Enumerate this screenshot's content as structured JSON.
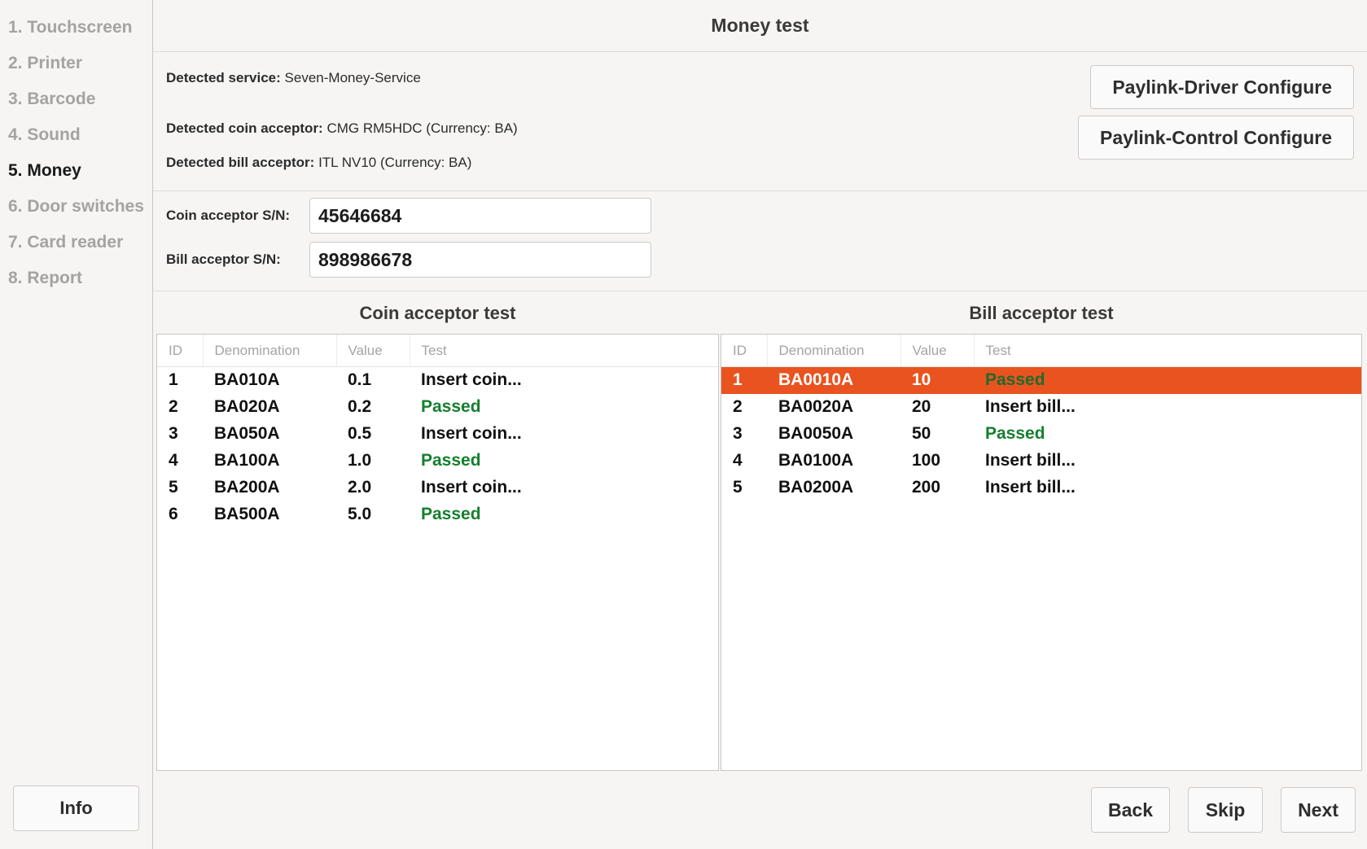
{
  "sidebar": {
    "items": [
      {
        "label": "1. Touchscreen",
        "active": false
      },
      {
        "label": "2. Printer",
        "active": false
      },
      {
        "label": "3. Barcode",
        "active": false
      },
      {
        "label": "4. Sound",
        "active": false
      },
      {
        "label": "5. Money",
        "active": true
      },
      {
        "label": "6. Door switches",
        "active": false
      },
      {
        "label": "7. Card reader",
        "active": false
      },
      {
        "label": "8. Report",
        "active": false
      }
    ],
    "info_label": "Info"
  },
  "header": {
    "title": "Money test"
  },
  "detected": {
    "service_label": "Detected service:",
    "service_value": "Seven-Money-Service",
    "coin_label": "Detected coin acceptor:",
    "coin_value": "CMG RM5HDC (Currency: BA)",
    "bill_label": "Detected bill acceptor:",
    "bill_value": "ITL NV10 (Currency: BA)"
  },
  "configure_buttons": {
    "driver": "Paylink-Driver Configure",
    "control": "Paylink-Control Configure"
  },
  "serial_numbers": {
    "coin_label": "Coin acceptor S/N:",
    "coin_value": "45646684",
    "coin_placeholder": "",
    "bill_label": "Bill acceptor S/N:",
    "bill_value": "898986678",
    "bill_placeholder": ""
  },
  "coin_table": {
    "caption": "Coin acceptor test",
    "columns": [
      "ID",
      "Denomination",
      "Value",
      "Test"
    ],
    "rows": [
      {
        "id": "1",
        "denomination": "BA010A",
        "value": "0.1",
        "test": "Insert coin...",
        "passed": false,
        "selected": false
      },
      {
        "id": "2",
        "denomination": "BA020A",
        "value": "0.2",
        "test": "Passed",
        "passed": true,
        "selected": false
      },
      {
        "id": "3",
        "denomination": "BA050A",
        "value": "0.5",
        "test": "Insert coin...",
        "passed": false,
        "selected": false
      },
      {
        "id": "4",
        "denomination": "BA100A",
        "value": "1.0",
        "test": "Passed",
        "passed": true,
        "selected": false
      },
      {
        "id": "5",
        "denomination": "BA200A",
        "value": "2.0",
        "test": "Insert coin...",
        "passed": false,
        "selected": false
      },
      {
        "id": "6",
        "denomination": "BA500A",
        "value": "5.0",
        "test": "Passed",
        "passed": true,
        "selected": false
      }
    ]
  },
  "bill_table": {
    "caption": "Bill acceptor test",
    "columns": [
      "ID",
      "Denomination",
      "Value",
      "Test"
    ],
    "rows": [
      {
        "id": "1",
        "denomination": "BA0010A",
        "value": "10",
        "test": "Passed",
        "passed": true,
        "selected": true
      },
      {
        "id": "2",
        "denomination": "BA0020A",
        "value": "20",
        "test": "Insert bill...",
        "passed": false,
        "selected": false
      },
      {
        "id": "3",
        "denomination": "BA0050A",
        "value": "50",
        "test": "Passed",
        "passed": true,
        "selected": false
      },
      {
        "id": "4",
        "denomination": "BA0100A",
        "value": "100",
        "test": "Insert bill...",
        "passed": false,
        "selected": false
      },
      {
        "id": "5",
        "denomination": "BA0200A",
        "value": "200",
        "test": "Insert bill...",
        "passed": false,
        "selected": false
      }
    ]
  },
  "footer": {
    "back": "Back",
    "skip": "Skip",
    "next": "Next"
  },
  "colors": {
    "accent": "#e9531f",
    "passed": "#157f2e",
    "background": "#f6f5f4",
    "panel": "#ffffff",
    "muted_text": "#a5a3a1"
  }
}
